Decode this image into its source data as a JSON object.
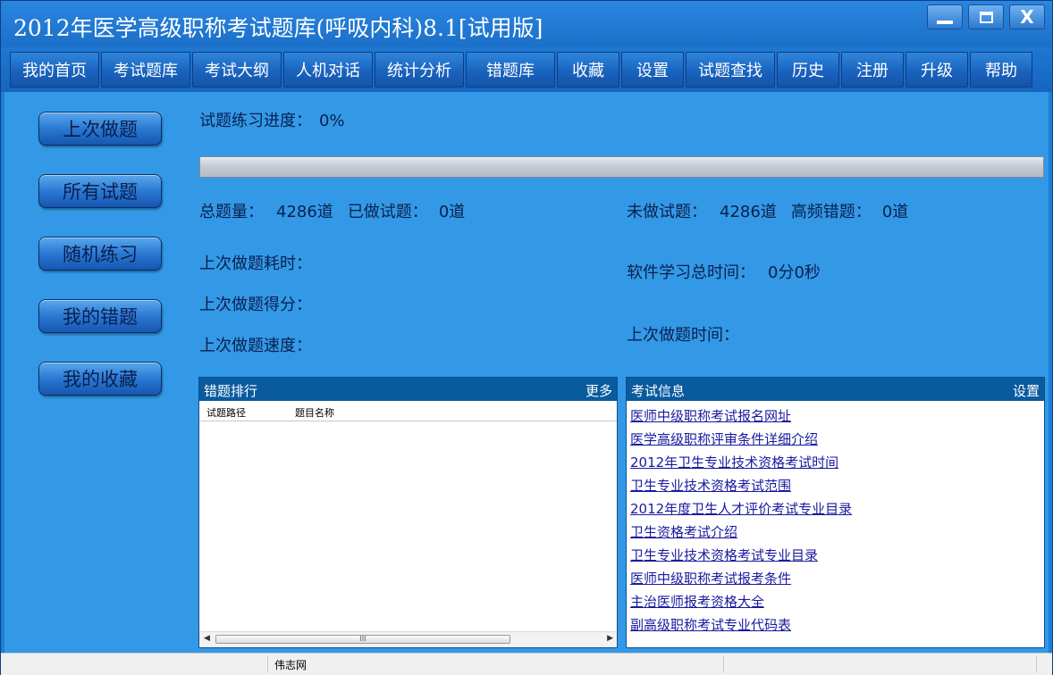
{
  "window": {
    "title": "2012年医学高级职称考试题库(呼吸内科)8.1[试用版]",
    "minimize_icon": "minimize-icon",
    "maximize_icon": "maximize-icon",
    "close_icon": "close-icon",
    "close_label": "X"
  },
  "menu": {
    "items": [
      {
        "label": "我的首页"
      },
      {
        "label": "考试题库"
      },
      {
        "label": "考试大纲"
      },
      {
        "label": "人机对话"
      },
      {
        "label": "统计分析"
      },
      {
        "label": "错题库"
      },
      {
        "label": "收藏"
      },
      {
        "label": "设置"
      },
      {
        "label": "试题查找"
      },
      {
        "label": "历史"
      },
      {
        "label": "注册"
      },
      {
        "label": "升级"
      },
      {
        "label": "帮助"
      }
    ]
  },
  "sidebar": {
    "buttons": [
      {
        "label": "上次做题"
      },
      {
        "label": "所有试题"
      },
      {
        "label": "随机练习"
      },
      {
        "label": "我的错题"
      },
      {
        "label": "我的收藏"
      }
    ]
  },
  "stats": {
    "progress_label": "试题练习进度：",
    "progress_value": "0%",
    "progress_fraction": 0,
    "total_label": "总题量：",
    "total_value": "4286道",
    "done_label": "已做试题：",
    "done_value": "0道",
    "undone_label": "未做试题：",
    "undone_value": "4286道",
    "frequent_wrong_label": "高频错题：",
    "frequent_wrong_value": "0道",
    "last_time_label": "上次做题耗时：",
    "last_score_label": "上次做题得分：",
    "last_speed_label": "上次做题速度：",
    "study_time_label": "软件学习总时间：",
    "study_time_value": "0分0秒",
    "last_date_label": "上次做题时间："
  },
  "wrong_panel": {
    "title": "错题排行",
    "more": "更多",
    "col_path": "试题路径",
    "col_name": "题目名称",
    "scroll_thumb": "III"
  },
  "exam_panel": {
    "title": "考试信息",
    "settings": "设置",
    "links": [
      "医师中级职称考试报名网址",
      "医学高级职称评审条件详细介绍",
      "2012年卫生专业技术资格考试时间",
      "卫生专业技术资格考试范围",
      "2012年度卫生人才评价考试专业目录",
      "卫生资格考试介绍",
      "卫生专业技术资格考试专业目录",
      "医师中级职称考试报考条件",
      "主治医师报考资格大全",
      "副高级职称考试专业代码表"
    ]
  },
  "status": {
    "text": "伟志网"
  }
}
